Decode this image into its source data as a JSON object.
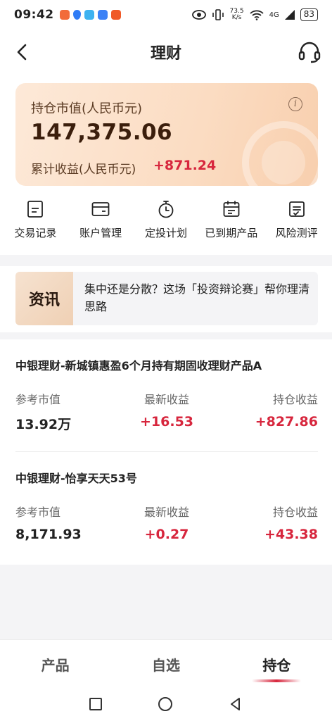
{
  "status_bar": {
    "time": "09:42",
    "speed_value": "73.5",
    "speed_unit": "K/s",
    "network": "4G",
    "battery": "83",
    "app_icon_colors": [
      "#f26b3a",
      "#2f7cf6",
      "#3db2f0",
      "#3b82f6",
      "#f05a28"
    ]
  },
  "nav": {
    "title": "理财",
    "back_icon": "chevron-left-icon",
    "service_icon": "headset-icon"
  },
  "summary": {
    "market_value_label": "持仓市值(人民币元)",
    "market_value": "147,375.06",
    "cumulative_label": "累计收益(人民币元)",
    "cumulative_value": "+871.24",
    "info_icon_glyph": "i"
  },
  "menu": [
    {
      "label": "交易记录",
      "icon": "document-icon"
    },
    {
      "label": "账户管理",
      "icon": "wallet-card-icon"
    },
    {
      "label": "定投计划",
      "icon": "stopwatch-icon"
    },
    {
      "label": "已到期产品",
      "icon": "calendar-icon"
    },
    {
      "label": "风险测评",
      "icon": "checklist-icon"
    }
  ],
  "news": {
    "badge": "资讯",
    "text": "集中还是分散？这场「投资辩论赛」帮你理清思路"
  },
  "holdings": [
    {
      "name": "中银理财-新城镇惠盈6个月持有期固收理财产品A",
      "col1_label": "参考市值",
      "col2_label": "最新收益",
      "col3_label": "持仓收益",
      "market_value": "13.92万",
      "latest_income": "+16.53",
      "holding_income": "+827.86"
    },
    {
      "name": "中银理财-怡享天天53号",
      "col1_label": "参考市值",
      "col2_label": "最新收益",
      "col3_label": "持仓收益",
      "market_value": "8,171.93",
      "latest_income": "+0.27",
      "holding_income": "+43.38"
    }
  ],
  "tabs": {
    "items": [
      "产品",
      "自选",
      "持仓"
    ],
    "active": "持仓"
  },
  "colors": {
    "accent_red": "#d7263d",
    "card_bg": "#fbdcc2",
    "value_brown": "#3b1e0c"
  }
}
